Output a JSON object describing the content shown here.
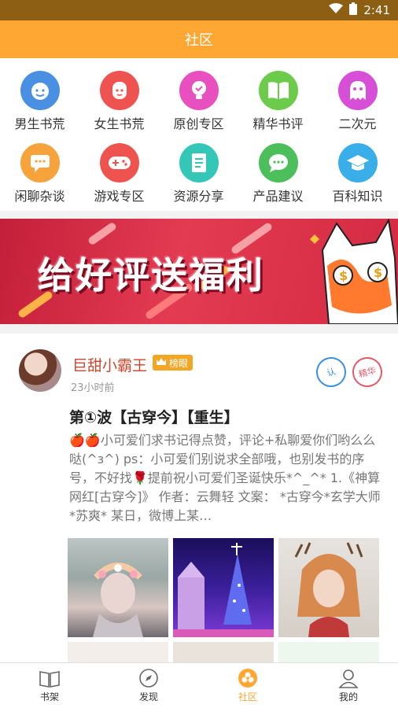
{
  "status_bar": {
    "time": "2:41"
  },
  "header": {
    "title": "社区"
  },
  "categories": [
    {
      "label": "男生书荒",
      "icon": "boy-face-icon",
      "color": "#4a90e2"
    },
    {
      "label": "女生书荒",
      "icon": "girl-face-icon",
      "color": "#ef5350"
    },
    {
      "label": "原创专区",
      "icon": "lightbulb-icon",
      "color": "#e84fbf"
    },
    {
      "label": "精华书评",
      "icon": "book-icon",
      "color": "#6ccb4a"
    },
    {
      "label": "二次元",
      "icon": "ghost-icon",
      "color": "#d64fd6"
    },
    {
      "label": "闲聊杂谈",
      "icon": "chat-bubble-icon",
      "color": "#f5a33a"
    },
    {
      "label": "游戏专区",
      "icon": "gamepad-icon",
      "color": "#ef5350"
    },
    {
      "label": "资源分享",
      "icon": "document-icon",
      "color": "#34c7b7"
    },
    {
      "label": "产品建议",
      "icon": "speech-icon",
      "color": "#4cbf5a"
    },
    {
      "label": "百科知识",
      "icon": "graduation-cap-icon",
      "color": "#3aaee8"
    }
  ],
  "banner": {
    "text": "给好评送福利"
  },
  "post": {
    "username": "巨甜小霸王",
    "badge": "榜眼",
    "time": "23小时前",
    "stamp_left": "认",
    "stamp_right": "精华",
    "title": "第①波【古穿今】【重生】",
    "body": "🍎🍎小可爱们求书记得点赞，评论+私聊爱你们哟么么哒(^з^) ps：小可爱们别说求全部哦，也别发书的序号，不好找🌹提前祝小可爱们圣诞快乐*^_^* 1.《神算网红[古穿今]》 作者：云舞轻 文案： *古穿今*玄学大师*苏爽* 某日，微博上某…"
  },
  "tabs": [
    {
      "label": "书架",
      "icon": "bookshelf-icon"
    },
    {
      "label": "发现",
      "icon": "compass-icon"
    },
    {
      "label": "社区",
      "icon": "community-icon"
    },
    {
      "label": "我的",
      "icon": "user-icon"
    }
  ],
  "colors": {
    "accent": "#ffa633",
    "statusbar": "#8d5f14",
    "username": "#c9452d"
  }
}
